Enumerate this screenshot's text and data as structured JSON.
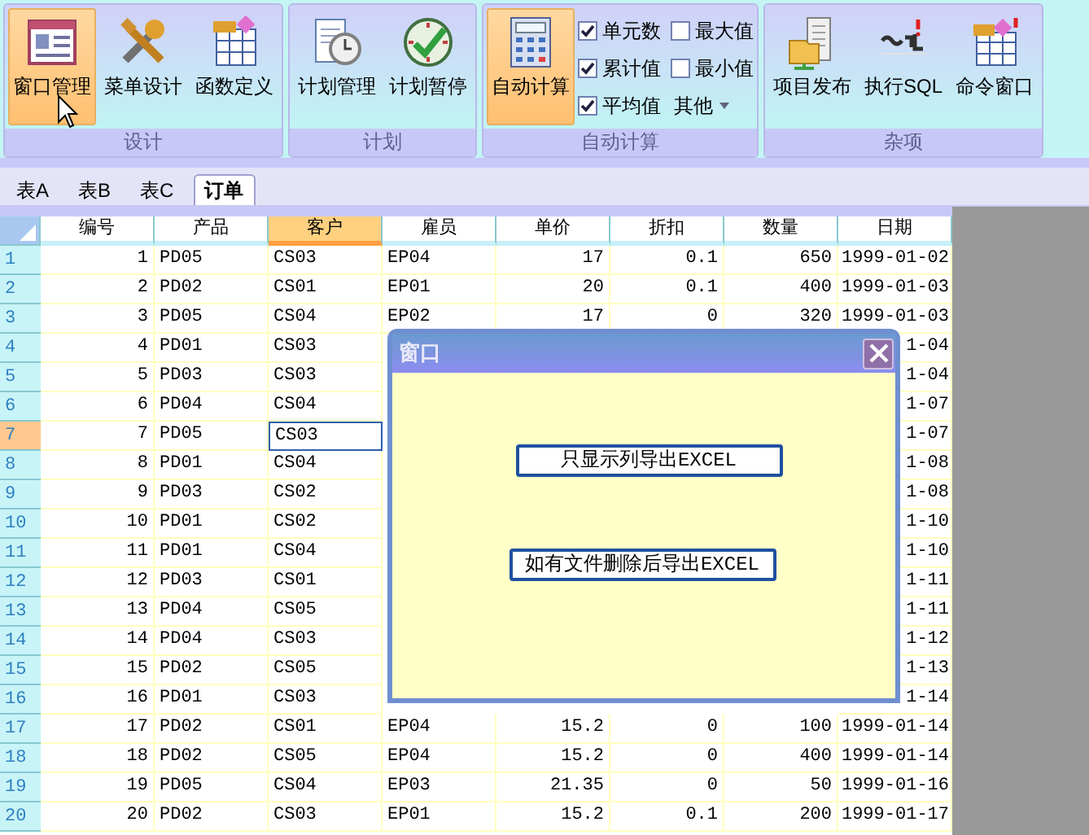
{
  "ribbon": {
    "groups": [
      {
        "label": "设计",
        "items": [
          {
            "kind": "button",
            "label": "窗口管理",
            "selected": true
          },
          {
            "kind": "button",
            "label": "菜单设计",
            "selected": false
          },
          {
            "kind": "button",
            "label": "函数定义",
            "selected": false
          }
        ]
      },
      {
        "label": "计划",
        "items": [
          {
            "kind": "button",
            "label": "计划管理",
            "selected": false
          },
          {
            "kind": "button",
            "label": "计划暂停",
            "selected": false
          }
        ]
      },
      {
        "label": "自动计算",
        "items": [
          {
            "kind": "button",
            "label": "自动计算",
            "selected": true
          },
          {
            "kind": "checkbox",
            "label": "单元数",
            "checked": true
          },
          {
            "kind": "checkbox",
            "label": "累计值",
            "checked": true
          },
          {
            "kind": "checkbox",
            "label": "平均值",
            "checked": true
          },
          {
            "kind": "checkbox",
            "label": "最大值",
            "checked": false
          },
          {
            "kind": "checkbox",
            "label": "最小值",
            "checked": false
          },
          {
            "kind": "dropdown",
            "label": "其他"
          }
        ]
      },
      {
        "label": "杂项",
        "items": [
          {
            "kind": "button",
            "label": "项目发布",
            "selected": false
          },
          {
            "kind": "button",
            "label": "执行SQL",
            "selected": false
          },
          {
            "kind": "button",
            "label": "命令窗口",
            "selected": false
          }
        ]
      }
    ]
  },
  "sheet_tabs": [
    {
      "label": "表A",
      "selected": false
    },
    {
      "label": "表B",
      "selected": false
    },
    {
      "label": "表C",
      "selected": false
    },
    {
      "label": "订单",
      "selected": true
    }
  ],
  "table": {
    "columns": [
      {
        "label": "编号",
        "selected": false
      },
      {
        "label": "产品",
        "selected": false
      },
      {
        "label": "客户",
        "selected": true
      },
      {
        "label": "雇员",
        "selected": false
      },
      {
        "label": "单价",
        "selected": false
      },
      {
        "label": "折扣",
        "selected": false
      },
      {
        "label": "数量",
        "selected": false
      },
      {
        "label": "日期",
        "selected": false
      }
    ],
    "rows": [
      {
        "header": "1",
        "selected": false,
        "cells": [
          "1",
          "PD05",
          "CS03",
          "EP04",
          "17",
          "0.1",
          "650",
          "1999-01-02"
        ]
      },
      {
        "header": "2",
        "selected": false,
        "cells": [
          "2",
          "PD02",
          "CS01",
          "EP01",
          "20",
          "0.1",
          "400",
          "1999-01-03"
        ]
      },
      {
        "header": "3",
        "selected": false,
        "cells": [
          "3",
          "PD05",
          "CS04",
          "EP02",
          "17",
          "0",
          "320",
          "1999-01-03"
        ]
      },
      {
        "header": "4",
        "selected": false,
        "cells": [
          "4",
          "PD01",
          "CS03",
          null,
          null,
          null,
          null,
          "1-04"
        ]
      },
      {
        "header": "5",
        "selected": false,
        "cells": [
          "5",
          "PD03",
          "CS03",
          null,
          null,
          null,
          null,
          "1-04"
        ]
      },
      {
        "header": "6",
        "selected": false,
        "cells": [
          "6",
          "PD04",
          "CS04",
          null,
          null,
          null,
          null,
          "1-07"
        ]
      },
      {
        "header": "7",
        "selected": true,
        "cells": [
          "7",
          "PD05",
          "CS03",
          null,
          null,
          null,
          null,
          "1-07"
        ]
      },
      {
        "header": "8",
        "selected": false,
        "cells": [
          "8",
          "PD01",
          "CS04",
          null,
          null,
          null,
          null,
          "1-08"
        ]
      },
      {
        "header": "9",
        "selected": false,
        "cells": [
          "9",
          "PD03",
          "CS02",
          null,
          null,
          null,
          null,
          "1-08"
        ]
      },
      {
        "header": "10",
        "selected": false,
        "cells": [
          "10",
          "PD01",
          "CS02",
          null,
          null,
          null,
          null,
          "1-10"
        ]
      },
      {
        "header": "11",
        "selected": false,
        "cells": [
          "11",
          "PD01",
          "CS04",
          null,
          null,
          null,
          null,
          "1-10"
        ]
      },
      {
        "header": "12",
        "selected": false,
        "cells": [
          "12",
          "PD03",
          "CS01",
          null,
          null,
          null,
          null,
          "1-11"
        ]
      },
      {
        "header": "13",
        "selected": false,
        "cells": [
          "13",
          "PD04",
          "CS05",
          null,
          null,
          null,
          null,
          "1-11"
        ]
      },
      {
        "header": "14",
        "selected": false,
        "cells": [
          "14",
          "PD04",
          "CS03",
          null,
          null,
          null,
          null,
          "1-12"
        ]
      },
      {
        "header": "15",
        "selected": false,
        "cells": [
          "15",
          "PD02",
          "CS05",
          null,
          null,
          null,
          null,
          "1-13"
        ]
      },
      {
        "header": "16",
        "selected": false,
        "cells": [
          "16",
          "PD01",
          "CS03",
          null,
          null,
          null,
          null,
          "1-14"
        ]
      },
      {
        "header": "17",
        "selected": false,
        "cells": [
          "17",
          "PD02",
          "CS01",
          "EP04",
          "15.2",
          "0",
          "100",
          "1999-01-14"
        ]
      },
      {
        "header": "18",
        "selected": false,
        "cells": [
          "18",
          "PD02",
          "CS05",
          "EP04",
          "15.2",
          "0",
          "400",
          "1999-01-14"
        ]
      },
      {
        "header": "19",
        "selected": false,
        "cells": [
          "19",
          "PD05",
          "CS04",
          "EP03",
          "21.35",
          "0",
          "50",
          "1999-01-16"
        ]
      },
      {
        "header": "20",
        "selected": false,
        "cells": [
          "20",
          "PD02",
          "CS03",
          "EP01",
          "15.2",
          "0.1",
          "200",
          "1999-01-17"
        ]
      }
    ]
  },
  "dialog": {
    "title": "窗口",
    "buttons": [
      "只显示列导出EXCEL",
      "如有文件删除后导出EXCEL"
    ]
  }
}
